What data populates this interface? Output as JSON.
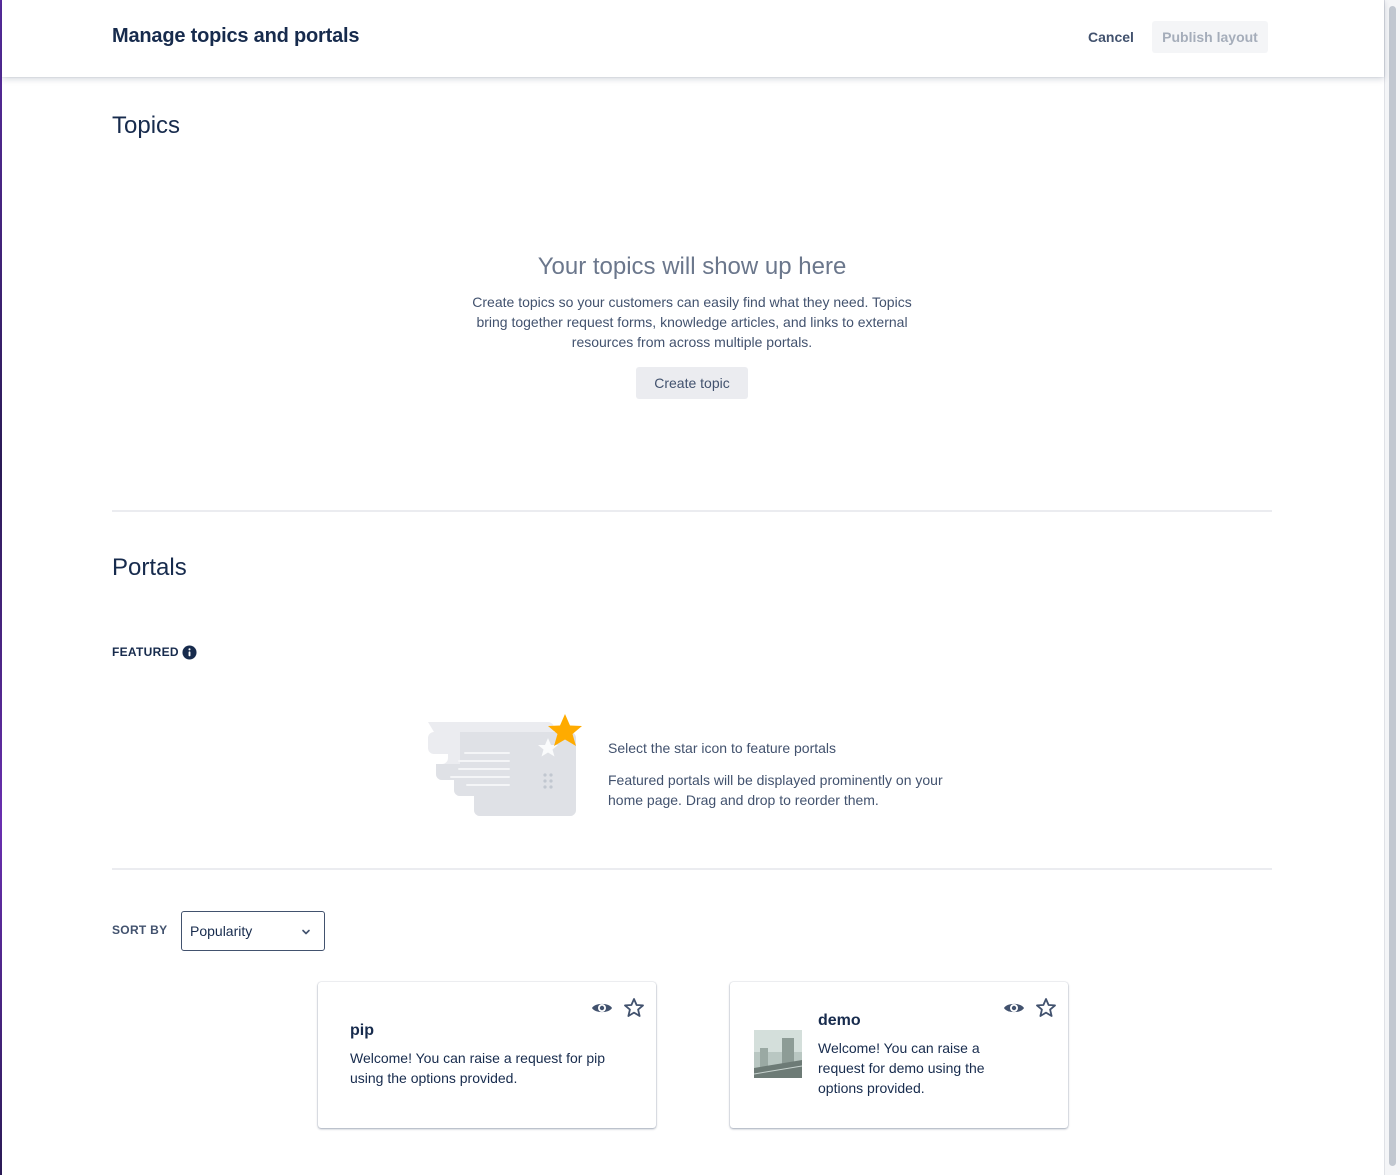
{
  "header": {
    "title": "Manage topics and portals",
    "cancel_label": "Cancel",
    "publish_label": "Publish layout"
  },
  "topics": {
    "heading": "Topics",
    "empty_title": "Your topics will show up here",
    "empty_description": "Create topics so your customers can easily find what they need. Topics bring together request forms, knowledge articles, and links to external resources from across multiple portals.",
    "create_button": "Create topic"
  },
  "portals": {
    "heading": "Portals",
    "featured_label": "FEATURED",
    "featured_empty_title": "Select the star icon to feature portals",
    "featured_empty_description": "Featured portals will be displayed prominently on your home page. Drag and drop to reorder them.",
    "sort_label": "SORT BY",
    "sort_value": "Popularity",
    "cards": [
      {
        "name": "pip",
        "description": "Welcome! You can raise a request for pip using the options provided.",
        "has_image": false
      },
      {
        "name": "demo",
        "description": "Welcome! You can raise a request for demo using the options provided.",
        "has_image": true
      }
    ]
  },
  "colors": {
    "star_accent": "#ffab00",
    "text_primary": "#172b4d",
    "text_subtle": "#42526e"
  }
}
